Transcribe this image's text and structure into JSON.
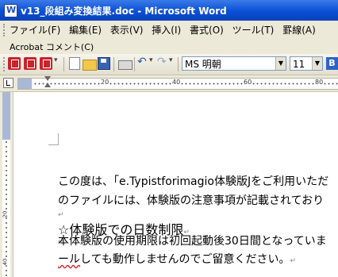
{
  "window": {
    "title": "v13_段組み変換結果.doc - Microsoft Word"
  },
  "menu": {
    "items": [
      "ファイル(F)",
      "編集(E)",
      "表示(V)",
      "挿入(I)",
      "書式(O)",
      "ツール(T)",
      "罫線(A)"
    ],
    "row2": "Acrobat コメント(C)"
  },
  "toolbar": {
    "font_name": "MS 明朝",
    "font_size": "11",
    "bold_label": "B"
  },
  "ruler": {
    "ticks": [
      "20",
      "40",
      "60",
      "80"
    ]
  },
  "vruler": {
    "ticks": [
      "20",
      "40"
    ]
  },
  "document": {
    "paragraph1_line1": "この度は、「e.Typistforimagio体験版Jをご利用いただ",
    "paragraph1_line2": "のファイルには、体験版の注意事項が記載されており",
    "heading": "☆体験版での日数制限",
    "paragraph2_line1": "本体験版の使用期限は初回起動後30日間となっていま",
    "paragraph2_line2_underlined": "ール",
    "paragraph2_line2_rest": "しても動作しませんのでご留意ください。",
    "paragraph_mark": "↵",
    "small_mark": "↵"
  }
}
